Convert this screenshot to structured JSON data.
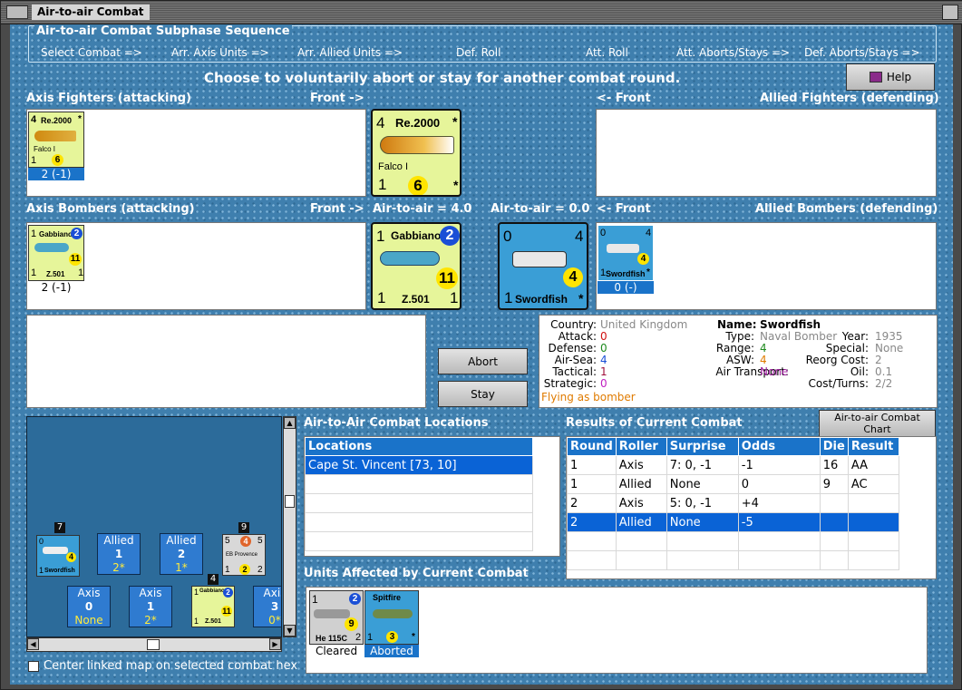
{
  "window": {
    "title": "Air-to-air Combat"
  },
  "sequence": {
    "title": "Air-to-air Combat Subphase Sequence",
    "steps": [
      "Select Combat =>",
      "Arr. Axis Units =>",
      "Arr. Allied Units =>",
      "Def. Roll",
      "Att. Roll",
      "Att. Aborts/Stays =>",
      "Def. Aborts/Stays =>"
    ]
  },
  "instruction": "Choose to voluntarily abort or stay for another combat round.",
  "help_label": "Help",
  "labels": {
    "axis_fighters": "Axis Fighters (attacking)",
    "front_right": "Front ->",
    "front_left": "<- Front",
    "allied_fighters": "Allied Fighters (defending)",
    "axis_bombers": "Axis Bombers (attacking)",
    "air_axis": "Air-to-air = 4.0",
    "air_allied": "Air-to-air = 0.0",
    "allied_bombers": "Allied Bombers (defending)"
  },
  "fighter_counter": {
    "attack": "4",
    "type": "Re.2000",
    "star": "*",
    "name": "Falco I",
    "left": "1",
    "strength": "6",
    "caption": "2 (-1)"
  },
  "axis_bomber_counter": {
    "left": "1",
    "type": "Gabbiano",
    "badge": "2",
    "strength": "11",
    "bottom_left": "1",
    "name": "Z.501",
    "bottom_right": "1",
    "caption": "2 (-1)"
  },
  "allied_bomber_counter": {
    "top_left": "0",
    "top_right": "4",
    "strength": "4",
    "bottom_left": "1",
    "name": "Swordfish",
    "star": "*",
    "caption": "0 (-)"
  },
  "buttons": {
    "abort": "Abort",
    "stay": "Stay",
    "chart": "Air-to-air Combat Chart"
  },
  "info": {
    "country_label": "Country:",
    "country": "United Kingdom",
    "attack_label": "Attack:",
    "attack": "0",
    "defense_label": "Defense:",
    "defense": "0",
    "airsea_label": "Air-Sea:",
    "airsea": "4",
    "tactical_label": "Tactical:",
    "tactical": "1",
    "strategic_label": "Strategic:",
    "strategic": "0",
    "flying": "Flying as bomber",
    "name_label": "Name:",
    "name": "Swordfish",
    "type_label": "Type:",
    "type": "Naval Bomber",
    "year_label": "Year:",
    "year": "1935",
    "range_label": "Range:",
    "range": "4",
    "special_label": "Special:",
    "special": "None",
    "asw_label": "ASW:",
    "asw": "4",
    "reorg_label": "Reorg Cost:",
    "reorg": "2",
    "transport_label": "Air Transport:",
    "transport": "None",
    "oil_label": "Oil:",
    "oil": "0.1",
    "cost_label": "Cost/Turns:",
    "cost": "2/2"
  },
  "colors": {
    "blue": "#1a73c9",
    "red": "#d01010",
    "green": "#1e8a1e",
    "orange": "#e07b00",
    "purple": "#a020a0",
    "gray": "#888888"
  },
  "locations": {
    "title": "Air-to-Air Combat Locations",
    "header": "Locations",
    "rows": [
      "Cape St. Vincent [73, 10]"
    ]
  },
  "results": {
    "title": "Results of Current Combat",
    "headers": [
      "Round",
      "Roller",
      "Surprise",
      "Odds",
      "Die",
      "Result"
    ],
    "rows": [
      [
        "1",
        "Axis",
        "7: 0, -1",
        "-1",
        "16",
        "AA"
      ],
      [
        "1",
        "Allied",
        "None",
        "0",
        "9",
        "AC"
      ],
      [
        "2",
        "Axis",
        "5: 0, -1",
        "+4",
        "",
        ""
      ],
      [
        "2",
        "Allied",
        "None",
        "-5",
        "",
        ""
      ]
    ]
  },
  "affected": {
    "title": "Units Affected by Current Combat",
    "unit1": {
      "left": "1",
      "badge": "2",
      "strength": "9",
      "name": "He 115C",
      "right": "2",
      "caption": "Cleared"
    },
    "unit2": {
      "name": "Spitfire",
      "left": "1",
      "strength": "3",
      "star": "*",
      "caption": "Aborted"
    }
  },
  "hexmap": {
    "boxes": [
      {
        "side": "Allied",
        "num": "1",
        "val": "2*"
      },
      {
        "side": "Allied",
        "num": "2",
        "val": "1*"
      },
      {
        "side": "Axis",
        "num": "0",
        "val": "None"
      },
      {
        "side": "Axis",
        "num": "1",
        "val": "2*"
      },
      {
        "side": "Axis",
        "num": "3",
        "val": "0*"
      }
    ],
    "badge7": "7",
    "badge9": "9",
    "badge4": "4",
    "sword": {
      "tl": "0",
      "tr": "4",
      "str": "4",
      "bl": "1",
      "name": "Swordfish"
    },
    "ship": {
      "tl": "5",
      "mid": "4",
      "tr": "5",
      "name": "EB Provence",
      "bl": "1",
      "str": "2",
      "br": "2"
    },
    "gab": {
      "tl": "1",
      "name": "Gabbiano",
      "badge": "2",
      "str": "11",
      "bl": "1",
      "model": "Z.501"
    }
  },
  "checkbox_label": "Center linked map on selected combat hex"
}
